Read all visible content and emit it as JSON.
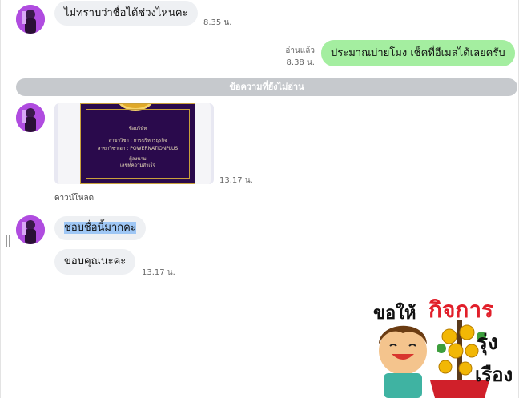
{
  "messages": {
    "m1": {
      "text": "ไม่ทราบว่าชื่อได้ช่วงไหนคะ",
      "time": "8.35 น."
    },
    "m2": {
      "status": "อ่านแล้ว",
      "time": "8.38 น.",
      "text": "ประมาณบ่ายโมง เช็คที่อีเมลได้เลยครับ"
    },
    "divider": "ข้อความที่ยังไม่อ่าน",
    "attachment": {
      "time": "13.17 น.",
      "download_label": "ดาวน์โหลด",
      "doc_lines": [
        "ชื่อบริษัท",
        "สาขาวิชา : การบริหารธุรกิจ",
        "สาขาวิชาเอก : POWERNATIONPLUS",
        "ผู้ลงนาม",
        "เลขที่ความสำเร็จ"
      ]
    },
    "m3": {
      "text": "ชอบชื่อนี้มากคะ"
    },
    "m4": {
      "text": "ขอบคุณนะคะ",
      "time": "13.17 น."
    }
  },
  "sticker": {
    "text1": "ขอให้",
    "text2": "กิจการ",
    "text3": "รุ่ง",
    "text4": "เรือง"
  },
  "colors": {
    "incoming_bubble": "#eef0f3",
    "outgoing_bubble": "#a4eea0",
    "divider": "#c6c9cd",
    "selection": "#9fc7f5",
    "sticker_red": "#e11f2a"
  }
}
